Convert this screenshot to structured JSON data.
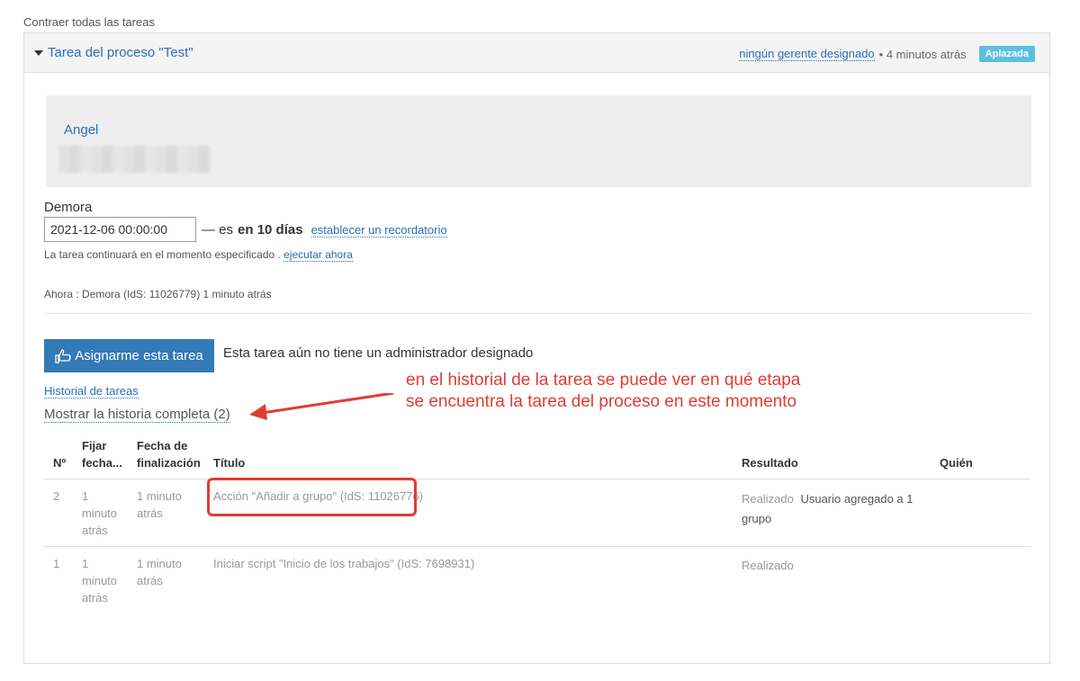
{
  "collapse_all": "Contraer todas las tareas",
  "task": {
    "title": "Tarea del proceso \"Test\"",
    "manager_link": "ningún gerente designado",
    "time_ago": "• 4 minutos atrás",
    "status_badge": "Aplazada",
    "status_color": "#5bc0de"
  },
  "contact": {
    "name": "Angel"
  },
  "delay": {
    "label": "Demora",
    "date_value": "2021-12-06 00:00:00",
    "prefix": "— es",
    "in_days": "en 10 días",
    "reminder_link": "establecer un recordatorio",
    "continue_text": "La tarea continuará en el momento especificado .",
    "execute_now_link": "ejecutar ahora",
    "now_text": "Ahora : Demora (IdS: 11026779) 1 minuto atrás"
  },
  "assign": {
    "button_label": "Asignarme esta tarea",
    "note": "Esta tarea aún no tiene un administrador designado"
  },
  "history": {
    "link": "Historial de tareas",
    "full_history_link": "Mostrar la historia completa (2)",
    "annotation_line1": "en el historial de la tarea se puede ver en qué etapa",
    "annotation_line2": "se encuentra la tarea del proceso en este momento",
    "annotation_color": "#e03c31",
    "columns": {
      "num": "Nº",
      "fixed_1": "Fijar",
      "fixed_2": "fecha...",
      "end_1": "Fecha de",
      "end_2": "finalización",
      "title": "Título",
      "result": "Resultado",
      "who": "Quién"
    },
    "rows": [
      {
        "num": "2",
        "fixed_1": "1",
        "fixed_2": "minuto",
        "fixed_3": "atrás",
        "end_1": "1 minuto",
        "end_2": "atrás",
        "title": "Acción \"Añadir a grupo\" (IdS: 11026776)",
        "result_status": "Realizado",
        "result_1": "Usuario agregado a 1",
        "result_2": "grupo"
      },
      {
        "num": "1",
        "fixed_1": "1",
        "fixed_2": "minuto",
        "fixed_3": "atrás",
        "end_1": "1 minuto",
        "end_2": "atrás",
        "title": "Iniciar script \"Inicio de los trabajos\" (IdS: 7698931)",
        "result_status": "Realizado"
      }
    ]
  }
}
